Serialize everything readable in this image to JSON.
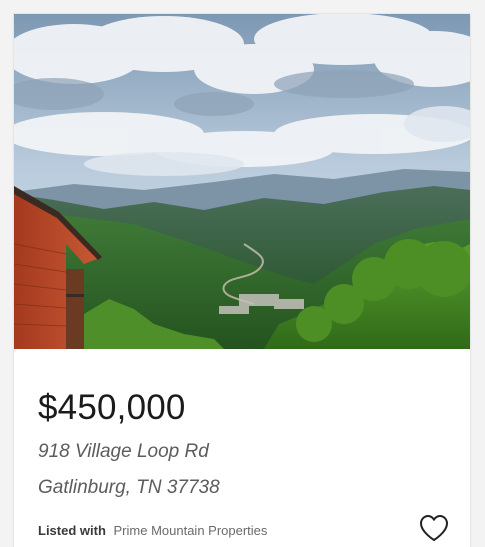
{
  "listing": {
    "photo_alt": "",
    "price": "$450,000",
    "address_line1": "918 Village Loop Rd",
    "address_line2": "Gatlinburg, TN 37738",
    "listed_with_label": "Listed with",
    "agent": "Prime Mountain Properties",
    "favorite_icon": "heart-outline-icon"
  },
  "colors": {
    "price_text": "#1b1b1b",
    "address_text": "#5c5c5c",
    "heart_stroke": "#222222"
  }
}
